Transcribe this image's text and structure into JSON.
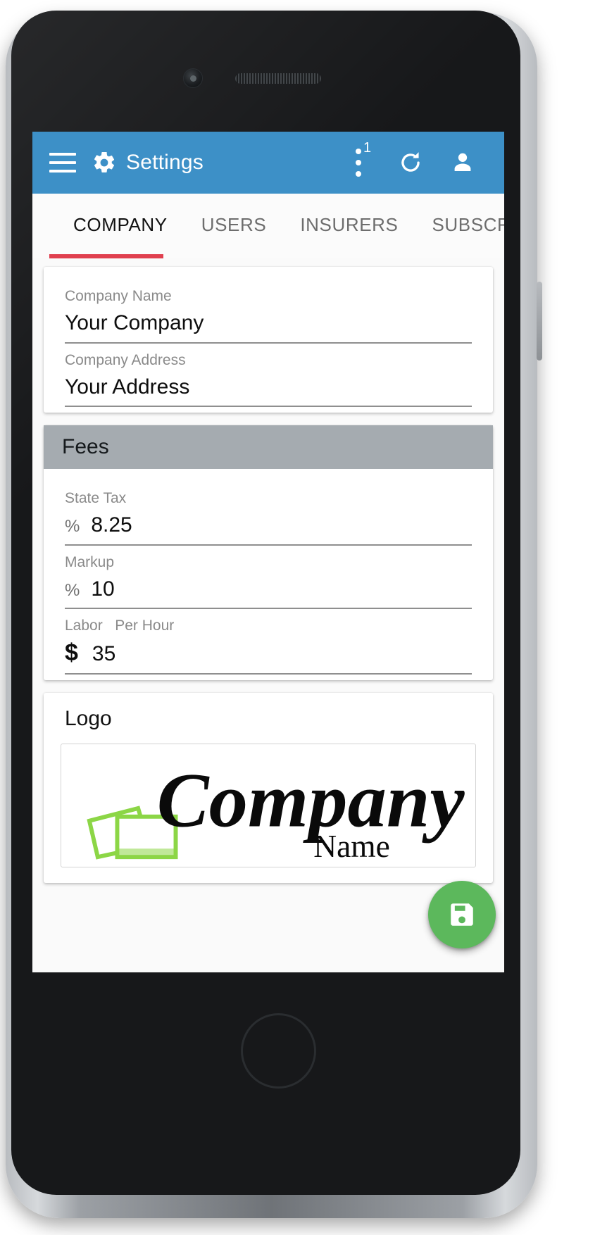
{
  "appbar": {
    "menu_icon": "hamburger-menu-icon",
    "app_icon": "gear-icon",
    "title": "Settings",
    "overflow_icon": "kebab-menu-icon",
    "overflow_badge": "1",
    "refresh_icon": "refresh-icon",
    "account_icon": "person-icon",
    "background_color": "#3D90C7"
  },
  "tabs": {
    "items": [
      {
        "label": "COMPANY",
        "active": true
      },
      {
        "label": "USERS",
        "active": false
      },
      {
        "label": "INSURERS",
        "active": false
      },
      {
        "label": "SUBSCRIPTION",
        "active": false
      }
    ],
    "indicator_color": "#E0404F"
  },
  "company_card": {
    "fields": [
      {
        "label": "Company Name",
        "value": "Your Company"
      },
      {
        "label": "Company Address",
        "value": "Your Address"
      }
    ]
  },
  "fees_card": {
    "section_title": "Fees",
    "section_bg": "#A5ABB0",
    "fields": [
      {
        "label": "State Tax",
        "prefix": "%",
        "value": "8.25"
      },
      {
        "label": "Markup",
        "prefix": "%",
        "value": "10"
      },
      {
        "label": "Labor   Per Hour",
        "prefix": "$",
        "value": "35"
      }
    ]
  },
  "logo_card": {
    "title": "Logo",
    "image": {
      "script_text": "Company",
      "serif_text": "Name",
      "accent_color": "#8CD646"
    }
  },
  "fab": {
    "icon": "save-icon",
    "color": "#5CB85C"
  }
}
